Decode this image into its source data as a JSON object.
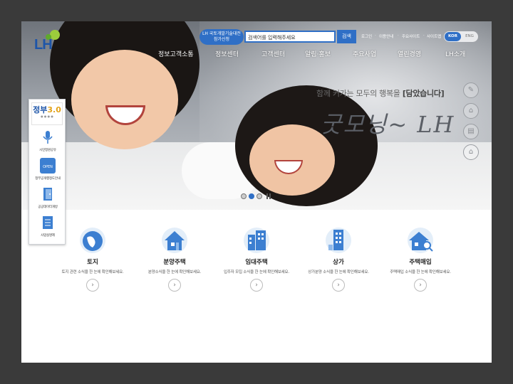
{
  "header": {
    "logo": "LH",
    "badge_line1": "LH 국토개발기술대전",
    "badge_line2": "참가신청",
    "search_placeholder": "검색어를 입력해주세요",
    "search_button": "검색",
    "util_links": [
      "로그인",
      "이용안내",
      "주요사이트",
      "사이트맵"
    ],
    "lang_kor": "KOR",
    "lang_eng": "ENG"
  },
  "gnb": [
    "정보고객소통",
    "정보센터",
    "고객센터",
    "알림·홍보",
    "주요사업",
    "열린경영",
    "LH소개"
  ],
  "hero": {
    "tagline_pre": "함께 커가는 모두의 행복을",
    "tagline_bold": "[담았습니다]",
    "script": "굿모닝~ LH"
  },
  "quick": {
    "gov_small": "정부3.0",
    "gov_big_a": "정부",
    "gov_big_b": "3.0",
    "items": [
      "시민청원공유",
      "정부공개행정도안내",
      "공공데이터개방",
      "사업실명제"
    ]
  },
  "categories": [
    {
      "title": "토지",
      "desc": "토지 관련 소식을 한 눈에 확인해보세요."
    },
    {
      "title": "분양주택",
      "desc": "분양소식을 한 눈에 확인해보세요."
    },
    {
      "title": "임대주택",
      "desc": "입주자 모집 소식을 한 눈에 확인해보세요."
    },
    {
      "title": "상가",
      "desc": "상가분양 소식을 한 눈에 확인해보세요."
    },
    {
      "title": "주택매입",
      "desc": "주택매입 소식을 한 눈에 확인해보세요."
    }
  ],
  "icons": {
    "side": [
      "pencil-icon",
      "tag-icon",
      "document-icon",
      "home-icon"
    ],
    "arrow": "›"
  },
  "colors": {
    "brand_blue": "#2f6fc6",
    "brand_green": "#9ccc3c"
  }
}
